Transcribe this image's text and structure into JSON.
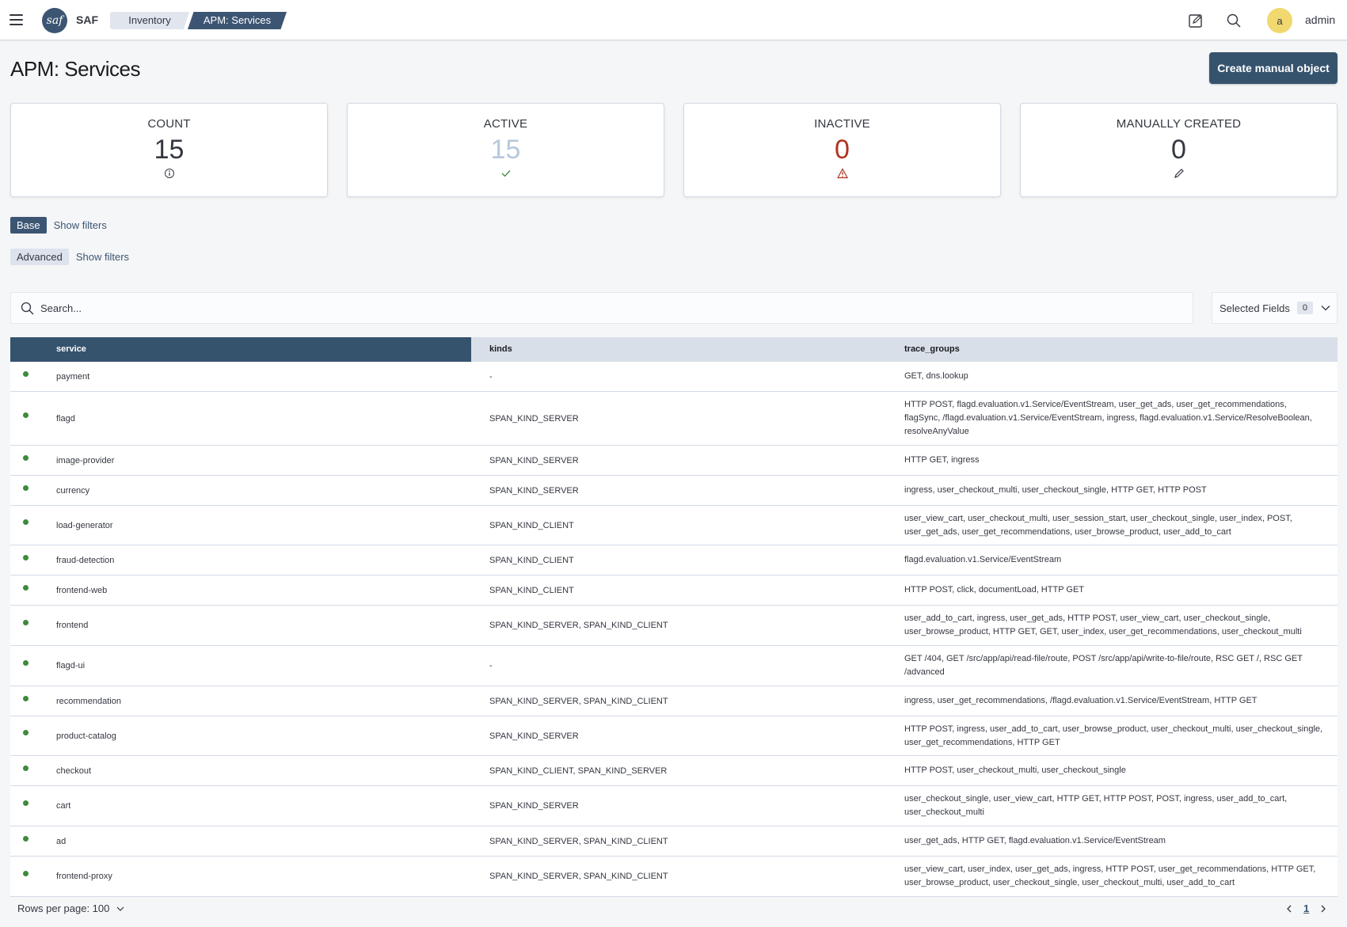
{
  "header": {
    "brand": "SAF",
    "logo_text": "saf",
    "breadcrumbs": [
      "Inventory",
      "APM: Services"
    ],
    "avatar_initial": "a",
    "username": "admin"
  },
  "page": {
    "title": "APM: Services",
    "create_button": "Create manual object"
  },
  "stats": [
    {
      "label": "COUNT",
      "value": "15",
      "color": "#343741",
      "icon": "info-icon"
    },
    {
      "label": "ACTIVE",
      "value": "15",
      "color": "#b6c9dc",
      "icon": "check-icon"
    },
    {
      "label": "INACTIVE",
      "value": "0",
      "color": "#b0331f",
      "icon": "warning-icon"
    },
    {
      "label": "MANUALLY CREATED",
      "value": "0",
      "color": "#343741",
      "icon": "pencil-icon"
    }
  ],
  "filters": {
    "base_label": "Base",
    "advanced_label": "Advanced",
    "show_filters": "Show filters"
  },
  "search": {
    "placeholder": "Search...",
    "selected_fields_label": "Selected Fields",
    "selected_fields_count": "0"
  },
  "table": {
    "columns": [
      "service",
      "kinds",
      "trace_groups"
    ],
    "status_color": "#3d8a3a",
    "rows": [
      {
        "service": "payment",
        "kinds": "-",
        "trace_groups": "GET, dns.lookup"
      },
      {
        "service": "flagd",
        "kinds": "SPAN_KIND_SERVER",
        "trace_groups": "HTTP POST, flagd.evaluation.v1.Service/EventStream, user_get_ads, user_get_recommendations, flagSync, /flagd.evaluation.v1.Service/EventStream, ingress, flagd.evaluation.v1.Service/ResolveBoolean, resolveAnyValue"
      },
      {
        "service": "image-provider",
        "kinds": "SPAN_KIND_SERVER",
        "trace_groups": "HTTP GET, ingress"
      },
      {
        "service": "currency",
        "kinds": "SPAN_KIND_SERVER",
        "trace_groups": "ingress, user_checkout_multi, user_checkout_single, HTTP GET, HTTP POST"
      },
      {
        "service": "load-generator",
        "kinds": "SPAN_KIND_CLIENT",
        "trace_groups": "user_view_cart, user_checkout_multi, user_session_start, user_checkout_single, user_index, POST, user_get_ads, user_get_recommendations, user_browse_product, user_add_to_cart"
      },
      {
        "service": "fraud-detection",
        "kinds": "SPAN_KIND_CLIENT",
        "trace_groups": "flagd.evaluation.v1.Service/EventStream"
      },
      {
        "service": "frontend-web",
        "kinds": "SPAN_KIND_CLIENT",
        "trace_groups": "HTTP POST, click, documentLoad, HTTP GET"
      },
      {
        "service": "frontend",
        "kinds": "SPAN_KIND_SERVER, SPAN_KIND_CLIENT",
        "trace_groups": "user_add_to_cart, ingress, user_get_ads, HTTP POST, user_view_cart, user_checkout_single, user_browse_product, HTTP GET, GET, user_index, user_get_recommendations, user_checkout_multi"
      },
      {
        "service": "flagd-ui",
        "kinds": "-",
        "trace_groups": "GET /404, GET /src/app/api/read-file/route, POST /src/app/api/write-to-file/route, RSC GET /, RSC GET /advanced"
      },
      {
        "service": "recommendation",
        "kinds": "SPAN_KIND_SERVER, SPAN_KIND_CLIENT",
        "trace_groups": "ingress, user_get_recommendations, /flagd.evaluation.v1.Service/EventStream, HTTP GET"
      },
      {
        "service": "product-catalog",
        "kinds": "SPAN_KIND_SERVER",
        "trace_groups": "HTTP POST, ingress, user_add_to_cart, user_browse_product, user_checkout_multi, user_checkout_single, user_get_recommendations, HTTP GET"
      },
      {
        "service": "checkout",
        "kinds": "SPAN_KIND_CLIENT, SPAN_KIND_SERVER",
        "trace_groups": "HTTP POST, user_checkout_multi, user_checkout_single"
      },
      {
        "service": "cart",
        "kinds": "SPAN_KIND_SERVER",
        "trace_groups": "user_checkout_single, user_view_cart, HTTP GET, HTTP POST, POST, ingress, user_add_to_cart, user_checkout_multi"
      },
      {
        "service": "ad",
        "kinds": "SPAN_KIND_SERVER, SPAN_KIND_CLIENT",
        "trace_groups": "user_get_ads, HTTP GET, flagd.evaluation.v1.Service/EventStream"
      },
      {
        "service": "frontend-proxy",
        "kinds": "SPAN_KIND_SERVER, SPAN_KIND_CLIENT",
        "trace_groups": "user_view_cart, user_index, user_get_ads, ingress, HTTP POST, user_get_recommendations, HTTP GET, user_browse_product, user_checkout_single, user_checkout_multi, user_add_to_cart"
      }
    ]
  },
  "footer": {
    "rows_per_page": "Rows per page: 100",
    "current_page": "1"
  }
}
